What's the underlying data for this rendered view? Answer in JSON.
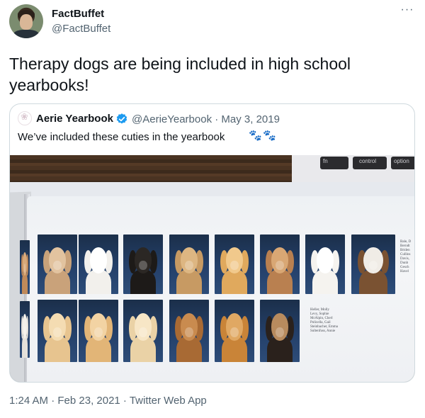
{
  "tweet": {
    "display_name": "FactBuffet",
    "handle": "@FactBuffet",
    "more_label": "···",
    "text": "Therapy dogs are being included in high school yearbooks!",
    "timestamp": "1:24 AM · Feb 23, 2021 · Twitter Web App"
  },
  "quoted": {
    "display_name": "Aerie Yearbook",
    "meta": "@AerieYearbook · May 3, 2019",
    "text": "We’ve included these cuties in the yearbook",
    "paw_glyph": "🐾",
    "verified_color": "#1d9bf0",
    "image": {
      "keys": [
        "fn",
        "control",
        "option"
      ],
      "names_right": "Bale, D\nBerndt\nBriden\nCullins\nDavis,\nDunb\nGesch\nHavel",
      "names_bottom": "Heller, Molly\nLevy, Sophie\nMcAlpin, Cherl\nPolicella, Gail\nSteinbacher, Emma\nSultenfuss, Annie"
    }
  },
  "colors": {
    "text": "#0f1419",
    "secondary": "#536471",
    "border": "#cfd9de"
  }
}
